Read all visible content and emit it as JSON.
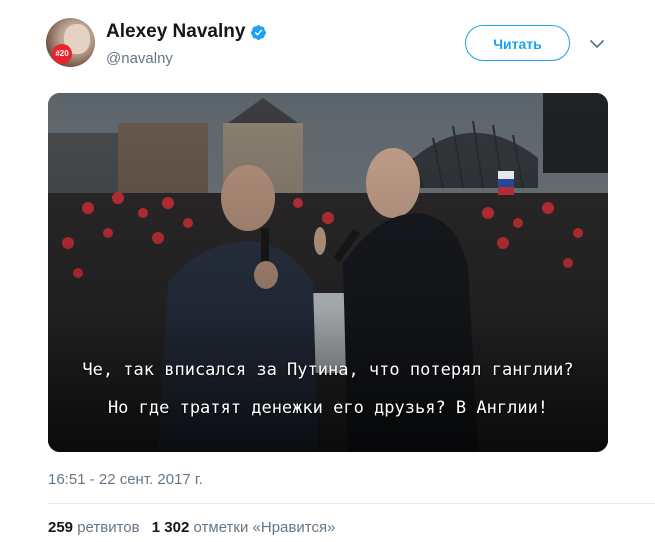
{
  "author": {
    "display_name": "Alexey Navalny",
    "handle": "@navalny",
    "avatar_badge": "#20",
    "verified": true
  },
  "follow_button": {
    "label": "Читать"
  },
  "menu": {
    "icon": "chevron-down-icon"
  },
  "media": {
    "caption_line_1": "Че, так вписался за Путина, что потерял ганглии?",
    "caption_line_2": "Но где тратят денежки его друзья? В Англии!"
  },
  "timestamp": "16:51 - 22 сент. 2017 г.",
  "stats": {
    "retweets_count": "259",
    "retweets_label": "ретвитов",
    "likes_count": "1 302",
    "likes_label": "отметки «Нравится»"
  },
  "colors": {
    "accent": "#1da1f2",
    "text_primary": "#14171a",
    "text_secondary": "#657786",
    "badge_red": "#e8232e",
    "divider": "#e6ecf0"
  }
}
